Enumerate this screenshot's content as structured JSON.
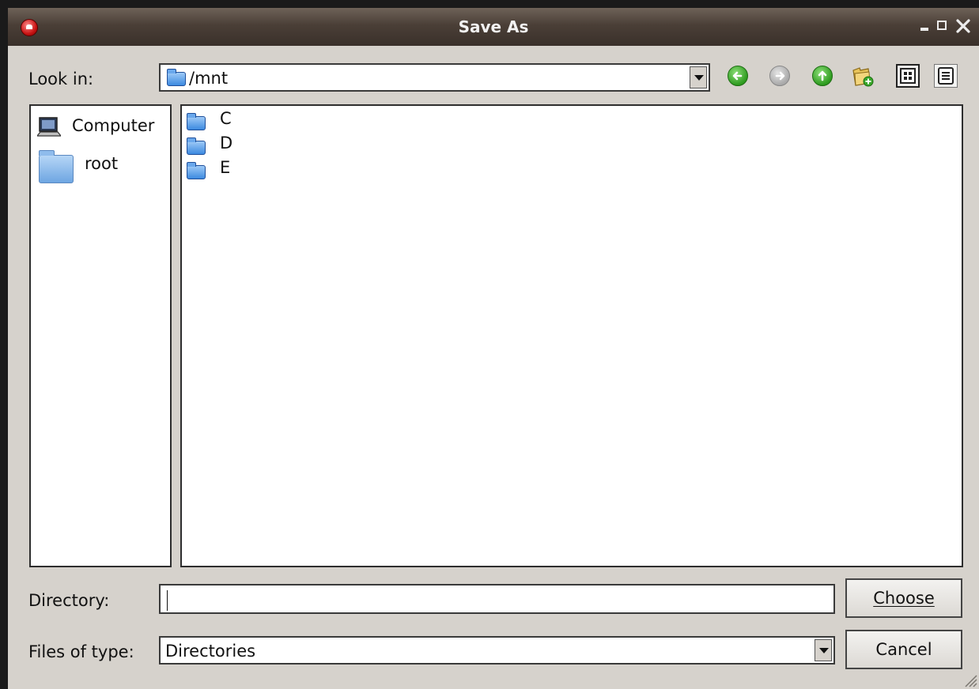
{
  "window": {
    "title": "Save As"
  },
  "look_in": {
    "label": "Look in:",
    "value": "/mnt"
  },
  "toolbar": {
    "back_icon": "arrow-left-icon",
    "forward_icon": "arrow-right-icon",
    "up_icon": "arrow-up-icon",
    "new_folder_icon": "new-folder-icon",
    "list_view_icon": "list-view-icon",
    "detail_view_icon": "detail-view-icon"
  },
  "sidebar": {
    "items": [
      {
        "label": "Computer",
        "icon": "computer-icon"
      },
      {
        "label": "root",
        "icon": "folder-icon"
      }
    ]
  },
  "files": [
    {
      "name": "C",
      "icon": "folder-icon"
    },
    {
      "name": "D",
      "icon": "folder-icon"
    },
    {
      "name": "E",
      "icon": "folder-icon"
    }
  ],
  "directory": {
    "label": "Directory:",
    "value": ""
  },
  "files_of_type": {
    "label": "Files of type:",
    "value": "Directories"
  },
  "buttons": {
    "choose": "Choose",
    "cancel": "Cancel"
  },
  "colors": {
    "titlebar": "#4a3f37",
    "window_bg": "#d6d2cc",
    "accent_green": "#2e9b1f",
    "folder_blue": "#3d8ae0"
  }
}
